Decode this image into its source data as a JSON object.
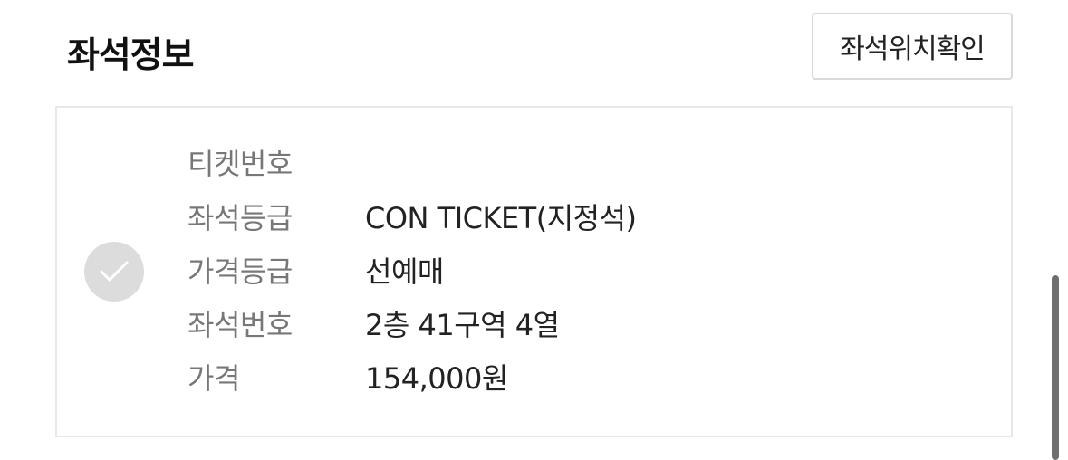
{
  "header": {
    "title": "좌석정보",
    "seat_location_button": "좌석위치확인"
  },
  "seat_info": {
    "rows": [
      {
        "label": "티켓번호",
        "value": ""
      },
      {
        "label": "좌석등급",
        "value": "CON TICKET(지정석)"
      },
      {
        "label": "가격등급",
        "value": "선예매"
      },
      {
        "label": "좌석번호",
        "value": "2층 41구역 4열"
      },
      {
        "label": "가격",
        "value": "154,000원"
      }
    ]
  },
  "icons": {
    "check": "check-icon"
  },
  "colors": {
    "title": "#111111",
    "label": "#777777",
    "value": "#222222",
    "border": "#e8e8e8",
    "check_circle": "#dcdcdc"
  }
}
